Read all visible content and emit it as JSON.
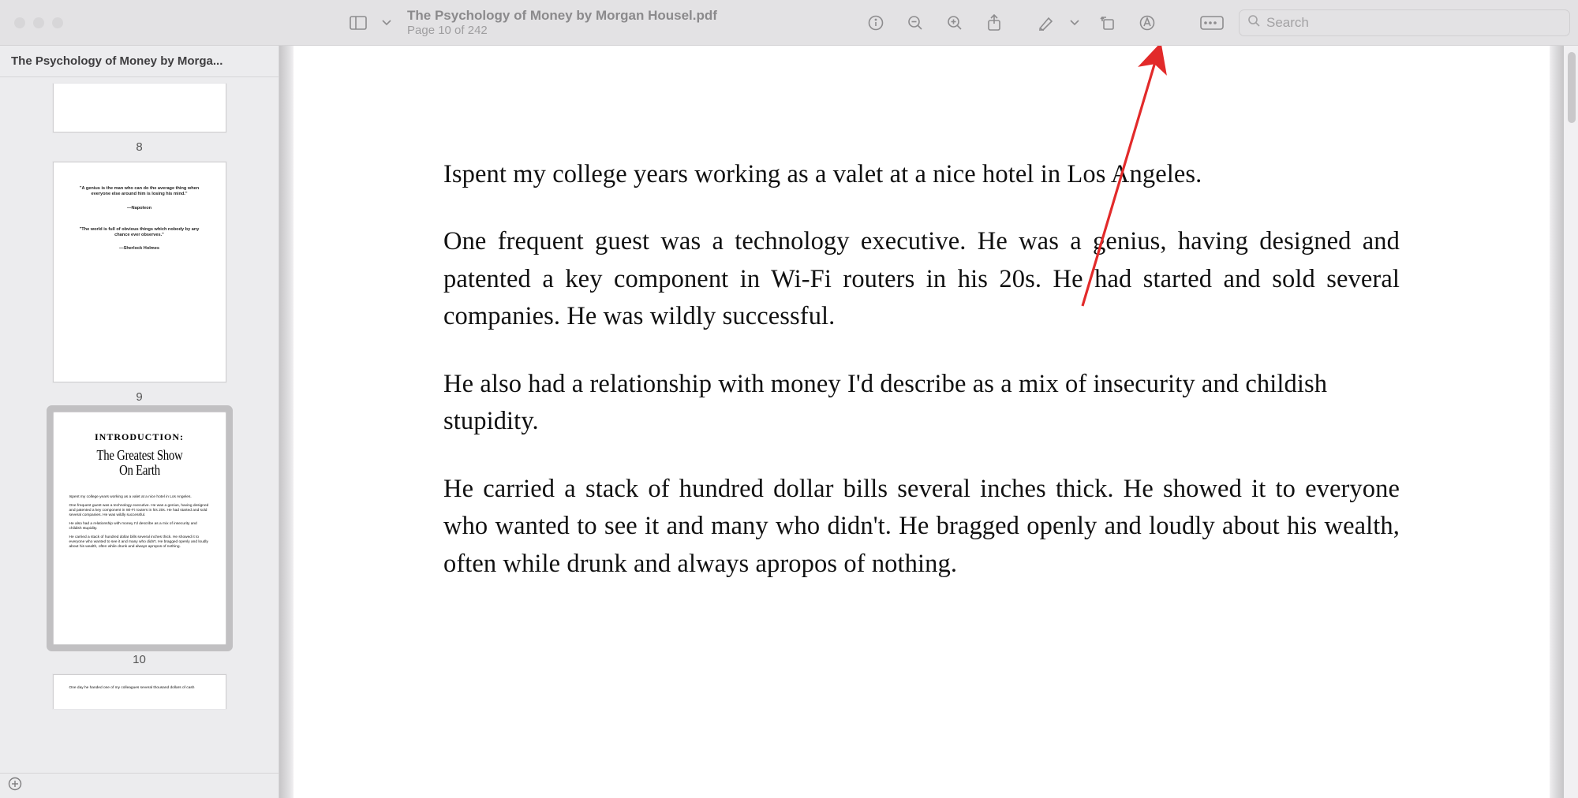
{
  "toolbar": {
    "doc_title": "The Psychology of Money by Morgan Housel.pdf",
    "page_status": "Page 10 of 242",
    "search_placeholder": "Search"
  },
  "sidebar": {
    "tab_label": "The Psychology of Money by Morga...",
    "thumbs": {
      "p8_num": "8",
      "p9_num": "9",
      "p10_num": "10",
      "p9_quote1": "\"A genius is the man who can do the average thing when everyone else around him is losing his mind.\"",
      "p9_attr1": "—Napoleon",
      "p9_quote2": "\"The world is full of obvious things which nobody by any chance ever observes.\"",
      "p9_attr2": "—Sherlock Holmes",
      "p10_intro_label": "INTRODUCTION:",
      "p10_intro_title1": "The Greatest Show",
      "p10_intro_title2": "On Earth",
      "p10_body1": "Ispent my college years working as a valet at a nice hotel in Los Angeles.",
      "p10_body2": "One frequent guest was a technology executive. He was a genius, having designed and patented a key component in Wi-Fi routers in his 20s. He had started and sold several companies. He was wildly successful.",
      "p10_body3": "He also had a relationship with money I'd describe as a mix of insecurity and childish stupidity.",
      "p10_body4": "He carried a stack of hundred dollar bills several inches thick. He showed it to everyone who wanted to see it and many who didn't. He bragged openly and loudly about his wealth, often while drunk and always apropos of nothing.",
      "p11_body": "One day he handed one of my colleagues several thousand dollars of cash"
    }
  },
  "page_content": {
    "para1": "Ispent my college years working as a valet at a nice hotel in Los Angeles.",
    "para2": "One frequent guest was a technology executive. He was a genius, having designed and patented a key component in Wi-Fi routers in his 20s. He had started and sold several companies. He was wildly successful.",
    "para3": "He also had a relationship with money I'd describe as a mix of insecurity and childish stupidity.",
    "para4": "He carried a stack of hundred dollar bills several inches thick. He showed it to everyone who wanted to see it and many who didn't. He bragged openly and loudly about his wealth, often while drunk and always apropos of nothing."
  },
  "annotation": {
    "arrow_color": "#e22a2a"
  }
}
